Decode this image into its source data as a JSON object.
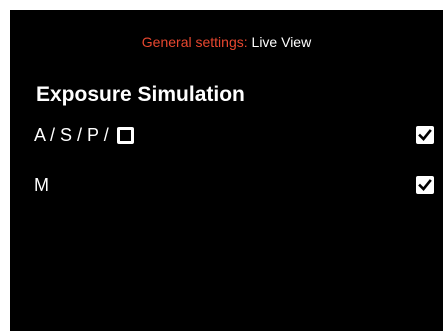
{
  "header": {
    "crumb": "General settings:",
    "current": "Live View"
  },
  "title": "Exposure Simulation",
  "options": [
    {
      "label": "A / S / P / ",
      "mode_icon": "square-mode-icon",
      "checked": true
    },
    {
      "label": "M",
      "checked": true
    }
  ],
  "colors": {
    "background": "#000000",
    "accent": "#e8472f",
    "text": "#ffffff"
  }
}
